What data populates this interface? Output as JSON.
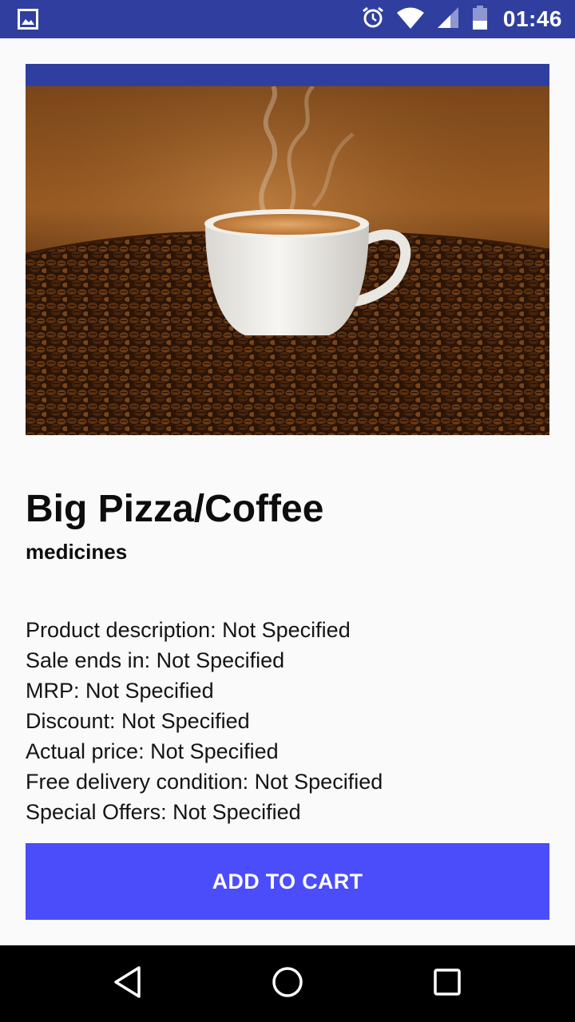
{
  "status_bar": {
    "time": "01:46",
    "icons": [
      "image-notification-icon",
      "alarm-icon",
      "wifi-icon",
      "cell-signal-icon",
      "battery-icon"
    ]
  },
  "product": {
    "image_icon": "coffee-cup-photo",
    "title": "Big Pizza/Coffee",
    "category": "medicines",
    "details": [
      "Product description: Not Specified",
      "Sale ends in: Not Specified",
      "MRP: Not Specified",
      "Discount: Not Specified",
      "Actual price: Not Specified",
      "Free delivery condition: Not Specified",
      "Special Offers: Not Specified"
    ]
  },
  "actions": {
    "add_to_cart_label": "ADD TO CART"
  },
  "nav": {
    "icons": [
      "back-icon",
      "home-icon",
      "recent-apps-icon"
    ]
  },
  "colors": {
    "status_bar": "#303f9f",
    "accent_button": "#4b4dfa",
    "background": "#fafafa",
    "nav_bar": "#000000"
  }
}
